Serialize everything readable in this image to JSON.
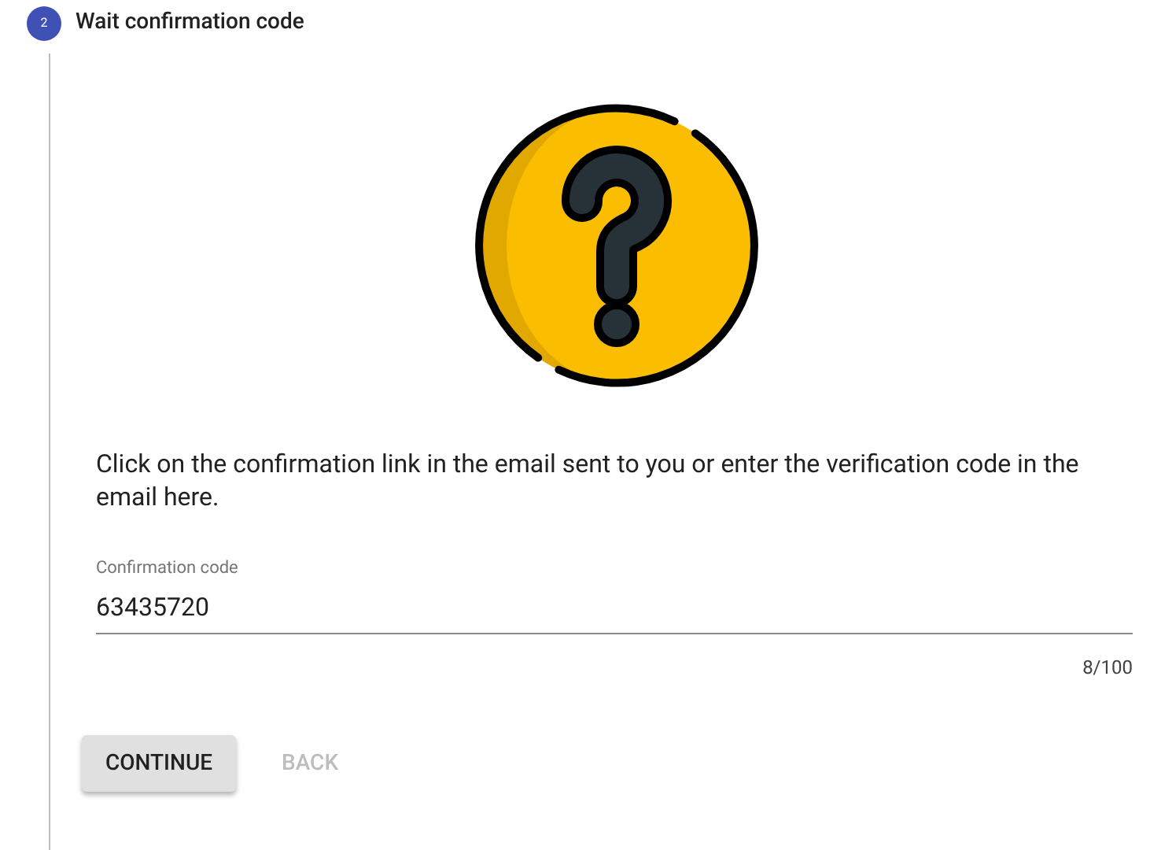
{
  "step": {
    "number": "2",
    "title": "Wait confirmation code",
    "active": true
  },
  "message": "Click on the confirmation link in the email sent to you or enter the verification code in the email here.",
  "field": {
    "label": "Confirmation code",
    "value": "63435720",
    "counter": "8/100"
  },
  "buttons": [
    {
      "label": "CONTINUE",
      "kind": "raised",
      "disabled": false
    },
    {
      "label": "BACK",
      "kind": "flat",
      "disabled": true
    }
  ]
}
